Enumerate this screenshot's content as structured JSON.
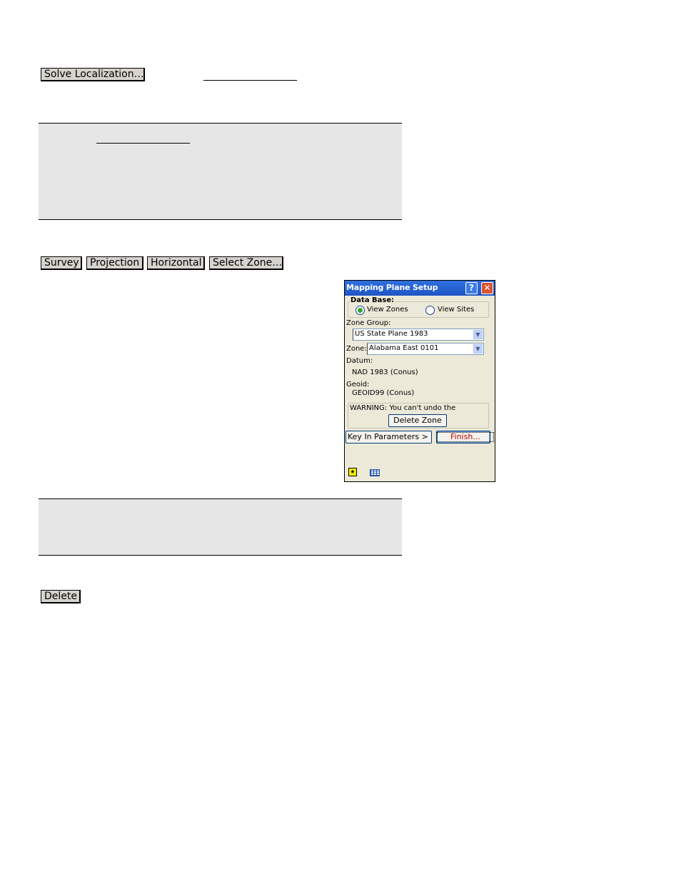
{
  "top_section": {
    "solve_localization_button": "Solve Localization…"
  },
  "tab_buttons": {
    "survey": "Survey",
    "projection": "Projection",
    "horizontal": "Horizontal",
    "select_zone": "Select Zone…"
  },
  "bottom_section": {
    "delete_button": "Delete"
  },
  "device": {
    "title": "Mapping Plane Setup",
    "help_label": "?",
    "close_label": "✕",
    "data_base_label": "Data Base:",
    "view_zones_label": "View Zones",
    "view_sites_label": "View Sites",
    "view_zones_selected": true,
    "zone_group_label": "Zone Group:",
    "zone_group_value": "US State Plane 1983",
    "zone_label": "Zone:",
    "zone_value": "Alabama East 0101",
    "datum_label": "Datum:",
    "datum_value": "NAD 1983 (Conus)",
    "geoid_label": "Geoid:",
    "geoid_value": "GEOID99 (Conus)",
    "warning_text": "WARNING: You can't undo the",
    "delete_zone_button": "Delete Zone",
    "key_in_parameters_button": "Key In Parameters >",
    "finish_button": "Finish..."
  }
}
